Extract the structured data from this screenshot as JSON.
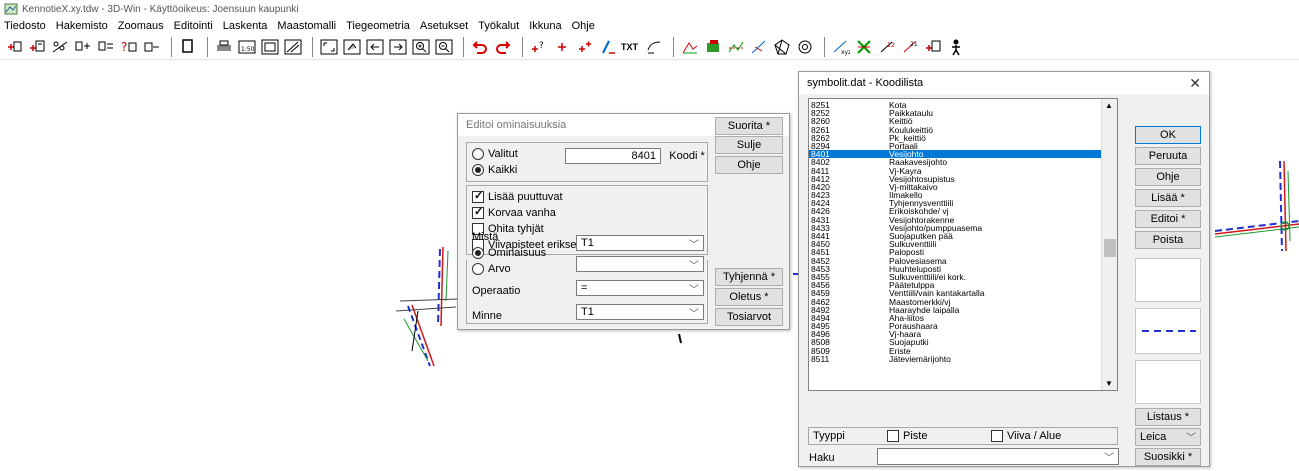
{
  "window": {
    "title": "KennotieX.xy.tdw - 3D-Win - Käyttöoikeus: Joensuun kaupunki"
  },
  "menu": [
    "Tiedosto",
    "Hakemisto",
    "Zoomaus",
    "Editointi",
    "Laskenta",
    "Maastomalli",
    "Tiegeometria",
    "Asetukset",
    "Työkalut",
    "Ikkuna",
    "Ohje"
  ],
  "toolbar": {
    "txt_label": "TXT"
  },
  "editor": {
    "title": "Editoi ominaisuuksia",
    "selection": {
      "selected_label": "Valitut",
      "all_label": "Kaikki",
      "code_value": "8401",
      "code_button": "Koodi *"
    },
    "options": {
      "add_missing": "Lisää puuttuvat",
      "replace_old": "Korvaa vanha",
      "skip_empty": "Ohita tyhjät",
      "separate_points": "Viivapisteet erikseen"
    },
    "source": {
      "from_label": "Mistä",
      "attribute_label": "Ominaisuus",
      "value_label": "Arvo",
      "attribute_value": "T1",
      "value_value": ""
    },
    "operation": {
      "label": "Operaatio",
      "value": "="
    },
    "target": {
      "label": "Minne",
      "value": "T1"
    },
    "buttons": {
      "run": "Suorita *",
      "close": "Sulje",
      "help": "Ohje",
      "clear": "Tyhjennä *",
      "defaults": "Oletus *",
      "true_values": "Tosiarvot"
    }
  },
  "code_list": {
    "title": "symbolit.dat - Koodilista",
    "items": [
      {
        "code": "8251",
        "name": "Kota"
      },
      {
        "code": "8252",
        "name": "Paikkataulu"
      },
      {
        "code": "8260",
        "name": "Keittiö"
      },
      {
        "code": "8261",
        "name": "Koulukeittiö"
      },
      {
        "code": "8262",
        "name": "Pk_keittiö"
      },
      {
        "code": "8294",
        "name": "Portaali"
      },
      {
        "code": "8401",
        "name": "Vesijohto"
      },
      {
        "code": "8402",
        "name": "Raakavesijohto"
      },
      {
        "code": "8411",
        "name": "Vj-Kayra"
      },
      {
        "code": "8412",
        "name": "Vesijohtosupistus"
      },
      {
        "code": "8420",
        "name": "Vj-mittakaivo"
      },
      {
        "code": "8423",
        "name": "Ilmakello"
      },
      {
        "code": "8424",
        "name": "Tyhjennysventtiili"
      },
      {
        "code": "8426",
        "name": "Erikoiskohde/ vj"
      },
      {
        "code": "8431",
        "name": "Vesijohtorakenne"
      },
      {
        "code": "8433",
        "name": "Vesijohto/pumppuasema"
      },
      {
        "code": "8441",
        "name": "Suojaputken pää"
      },
      {
        "code": "8450",
        "name": "Sulkuventtiili"
      },
      {
        "code": "8451",
        "name": "Paloposti"
      },
      {
        "code": "8452",
        "name": "Palovesiasema"
      },
      {
        "code": "8453",
        "name": "Huuhteluposti"
      },
      {
        "code": "8455",
        "name": "Sulkuventtiili/ei kork."
      },
      {
        "code": "8456",
        "name": "Päätetulppa"
      },
      {
        "code": "8459",
        "name": "Venttiili/vain kantakartalla"
      },
      {
        "code": "8462",
        "name": "Maastomerkki/vj"
      },
      {
        "code": "8492",
        "name": "Haarayhde laipalla"
      },
      {
        "code": "8494",
        "name": "Aha-liitos"
      },
      {
        "code": "8495",
        "name": "Poraushaara"
      },
      {
        "code": "8496",
        "name": "Vj-haara"
      },
      {
        "code": "8508",
        "name": "Suojaputki"
      },
      {
        "code": "8509",
        "name": "Eriste"
      },
      {
        "code": "8511",
        "name": "Jäteviemärijohto"
      }
    ],
    "selected_code": "8401",
    "buttons": {
      "ok": "OK",
      "cancel": "Peruuta",
      "help": "Ohje",
      "add": "Lisää *",
      "edit": "Editoi *",
      "delete": "Poista",
      "listing": "Listaus *",
      "favorite": "Suosikki *"
    },
    "device_value": "Leica",
    "type": {
      "label": "Tyyppi",
      "point": "Piste",
      "line_area": "Viiva / Alue"
    },
    "search": {
      "label": "Haku",
      "value": ""
    }
  },
  "colors": {
    "selection": "#0078d7",
    "line_blue": "#1f2fd0",
    "line_red": "#d01818",
    "line_green": "#1a9a30"
  }
}
